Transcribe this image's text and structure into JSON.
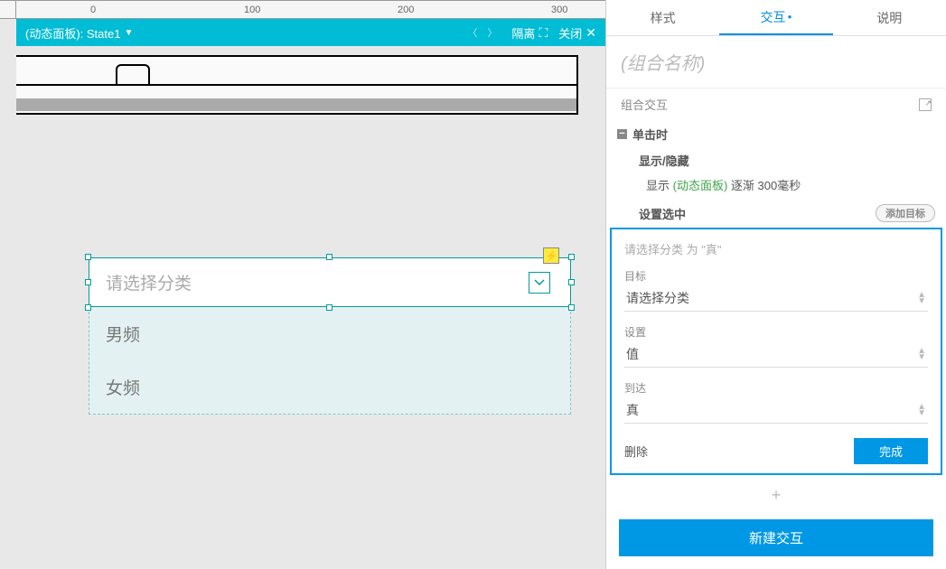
{
  "canvas": {
    "ruler_ticks": [
      "0",
      "100",
      "200",
      "300"
    ],
    "panel_name": "(动态面板):  State1",
    "isolate": "隔离",
    "close": "关闭"
  },
  "dropdown": {
    "placeholder": "请选择分类",
    "options": [
      "男频",
      "女频"
    ]
  },
  "panel": {
    "tabs": {
      "style": "样式",
      "interact": "交互",
      "notes": "说明"
    },
    "name_placeholder": "(组合名称)",
    "section_title": "组合交互",
    "event": "单击时",
    "action1_title": "显示/隐藏",
    "action1_detail_prefix": "显示 ",
    "action1_detail_target": "(动态面板)",
    "action1_detail_suffix": " 逐渐 300毫秒",
    "action2_title": "设置选中",
    "add_target": "添加目标",
    "edit_summary": "请选择分类 为 \"真\"",
    "target_label": "目标",
    "target_value": "请选择分类",
    "set_label": "设置",
    "set_value": "值",
    "to_label": "到达",
    "to_value": "真",
    "delete": "删除",
    "done": "完成",
    "new_interaction": "新建交互"
  }
}
